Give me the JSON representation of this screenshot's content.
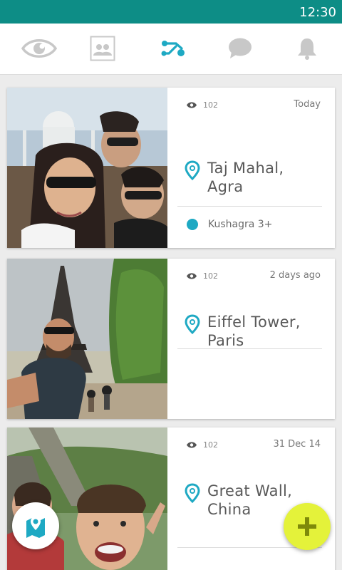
{
  "status_bar": {
    "time": "12:30"
  },
  "nav": {
    "items": [
      {
        "icon": "eye-icon",
        "active": false
      },
      {
        "icon": "people-card-icon",
        "active": false
      },
      {
        "icon": "share-route-icon",
        "active": true
      },
      {
        "icon": "chat-bubble-icon",
        "active": false
      },
      {
        "icon": "bell-icon",
        "active": false
      }
    ],
    "active_color": "#1ea9c3",
    "inactive_color": "#c8c8c8"
  },
  "cards": [
    {
      "views": "102",
      "date": "Today",
      "place_line1": "Taj Mahal,",
      "place_line2": "Agra",
      "people": "Kushagra 3+"
    },
    {
      "views": "102",
      "date": "2 days ago",
      "place_line1": "Eiffel Tower,",
      "place_line2": "Paris"
    },
    {
      "views": "102",
      "date": "31 Dec 14",
      "place_line1": "Great Wall,",
      "place_line2": "China"
    }
  ],
  "fab": {
    "map_icon": "map-pin-icon",
    "add_icon": "plus-icon",
    "add_color": "#e4f23a"
  },
  "colors": {
    "status_bar": "#0d8d86",
    "accent": "#1ea9c3"
  }
}
